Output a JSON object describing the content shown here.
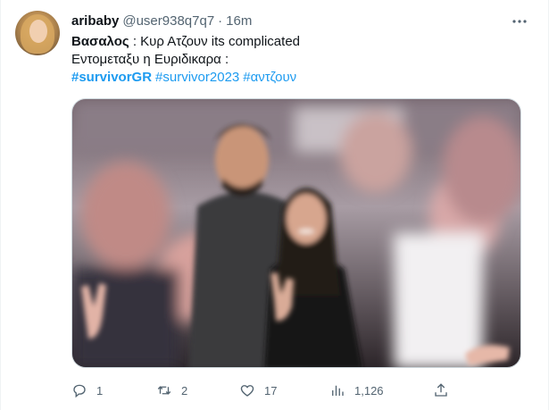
{
  "tweet": {
    "display_name": "aribaby",
    "handle": "@user938q7q7",
    "separator": "·",
    "time": "16m",
    "line1_bold": "Βασαλος",
    "line1_rest": " : Κυρ Ατζουν its complicated",
    "line2": "Εντομεταξυ η Ευριδικαρα :",
    "hashtags": [
      "#survivorGR",
      "#survivor2023",
      "#αντζουν"
    ]
  },
  "actions": {
    "reply_count": "1",
    "retweet_count": "2",
    "like_count": "17",
    "views_count": "1,126"
  },
  "icons": {
    "more": "more-dots-icon",
    "reply": "reply-icon",
    "retweet": "retweet-icon",
    "like": "heart-icon",
    "views": "views-bar-chart-icon",
    "share": "share-icon"
  },
  "colors": {
    "link": "#1d9bf0",
    "secondary_text": "#536471",
    "primary_text": "#0f1419",
    "border": "#cfd9de"
  }
}
